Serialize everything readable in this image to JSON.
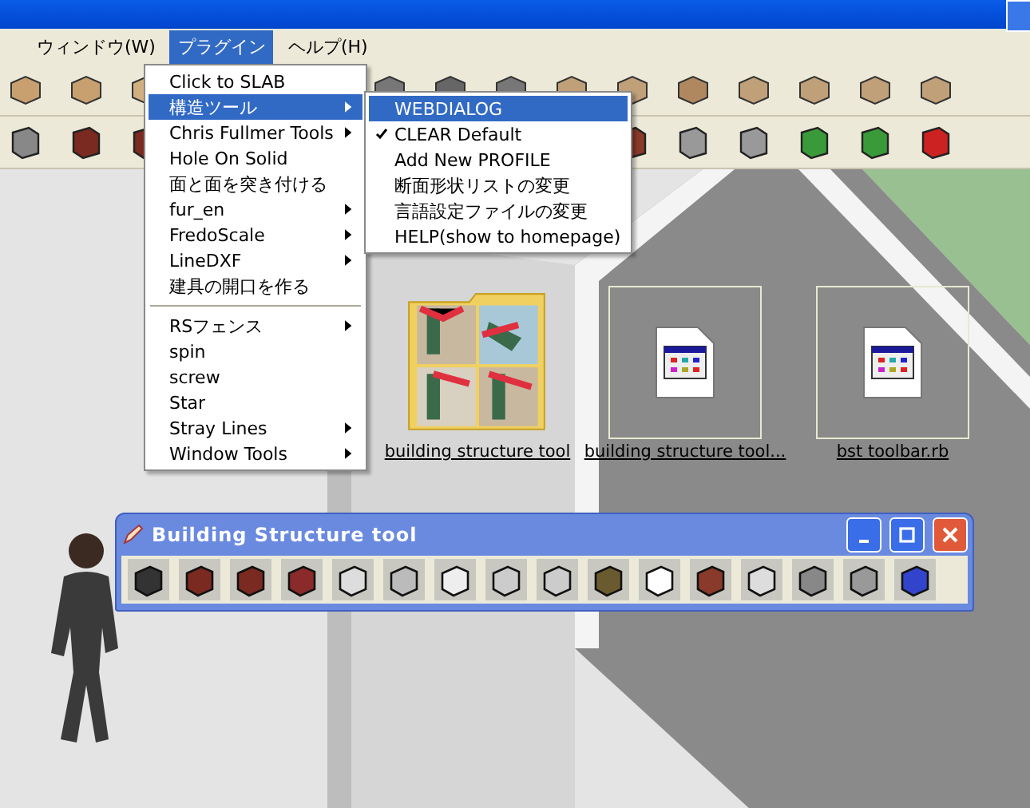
{
  "menu_bar": [
    {
      "label": "ウィンドウ(W)",
      "selected": false
    },
    {
      "label": "プラグイン",
      "selected": true
    },
    {
      "label": "ヘルプ(H)",
      "selected": false
    }
  ],
  "plugin_menu": {
    "groups": [
      [
        {
          "label": "Click to SLAB",
          "has_submenu": false,
          "selected": false
        },
        {
          "label": "構造ツール",
          "has_submenu": true,
          "selected": true
        },
        {
          "label": "Chris Fullmer Tools",
          "has_submenu": true,
          "selected": false
        },
        {
          "label": "Hole On Solid",
          "has_submenu": false,
          "selected": false
        },
        {
          "label": "面と面を突き付ける",
          "has_submenu": false,
          "selected": false
        },
        {
          "label": "fur_en",
          "has_submenu": true,
          "selected": false
        },
        {
          "label": "FredoScale",
          "has_submenu": true,
          "selected": false
        },
        {
          "label": "LineDXF",
          "has_submenu": true,
          "selected": false
        },
        {
          "label": "建具の開口を作る",
          "has_submenu": false,
          "selected": false
        }
      ],
      [
        {
          "label": "RSフェンス",
          "has_submenu": true,
          "selected": false
        },
        {
          "label": "spin",
          "has_submenu": false,
          "selected": false
        },
        {
          "label": "screw",
          "has_submenu": false,
          "selected": false
        },
        {
          "label": "Star",
          "has_submenu": false,
          "selected": false
        },
        {
          "label": "Stray Lines",
          "has_submenu": true,
          "selected": false
        },
        {
          "label": "Window Tools",
          "has_submenu": true,
          "selected": false
        }
      ]
    ]
  },
  "submenu": {
    "items": [
      {
        "label": "WEBDIALOG",
        "selected": true,
        "checked": false
      },
      {
        "label": "CLEAR Default",
        "selected": false,
        "checked": true
      },
      {
        "label": "Add New PROFILE",
        "selected": false,
        "checked": false
      },
      {
        "label": "断面形状リストの変更",
        "selected": false,
        "checked": false
      },
      {
        "label": "言語設定ファイルの変更",
        "selected": false,
        "checked": false
      },
      {
        "label": "HELP(show to homepage)",
        "selected": false,
        "checked": false
      }
    ]
  },
  "files": [
    {
      "name": "building structure tool",
      "kind": "folder"
    },
    {
      "name": "building structure tool...",
      "kind": "script"
    },
    {
      "name": "bst toolbar.rb",
      "kind": "script"
    }
  ],
  "floating_toolbar": {
    "title": "Building Structure tool"
  }
}
